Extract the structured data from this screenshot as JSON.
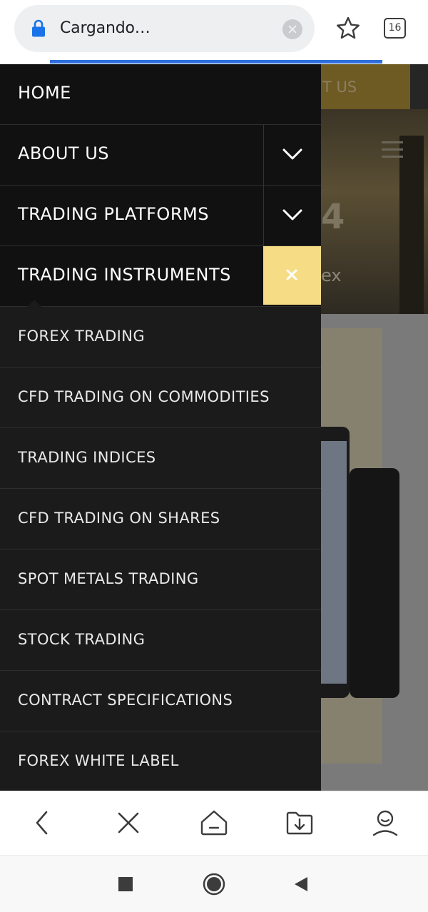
{
  "browser": {
    "url_status": "Cargando…",
    "tab_count": "16",
    "load_progress": 0.88,
    "icons": [
      "lock-icon",
      "clear-url-icon",
      "bookmark-star-icon",
      "tabs-icon"
    ]
  },
  "background_page": {
    "contact_text": "T US",
    "hero_glyph": "4",
    "hero_text": "ex"
  },
  "menu": {
    "top_items": [
      {
        "label": "HOME",
        "has_toggle": false
      },
      {
        "label": "ABOUT US",
        "has_toggle": true,
        "state": "collapsed"
      },
      {
        "label": "TRADING PLATFORMS",
        "has_toggle": true,
        "state": "collapsed"
      },
      {
        "label": "TRADING INSTRUMENTS",
        "has_toggle": true,
        "state": "expanded"
      }
    ],
    "sub_items": [
      "FOREX TRADING",
      "CFD TRADING ON COMMODITIES",
      "TRADING INDICES",
      "CFD TRADING ON SHARES",
      "SPOT METALS TRADING",
      "STOCK TRADING",
      "CONTRACT SPECIFICATIONS",
      "FOREX WHITE LABEL"
    ],
    "toggle_open_color": "#f6dc84"
  },
  "toolbar": {
    "icons": [
      "back-icon",
      "stop-icon",
      "home-icon",
      "downloads-icon",
      "profile-icon"
    ]
  },
  "system_nav": {
    "icons": [
      "recents-icon",
      "home-circle-icon",
      "back-triangle-icon"
    ]
  },
  "colors": {
    "menu_bg": "#1b1b1b",
    "menu_top_bg": "#111111",
    "accent": "#f6dc84",
    "progress": "#2f6fdb"
  }
}
